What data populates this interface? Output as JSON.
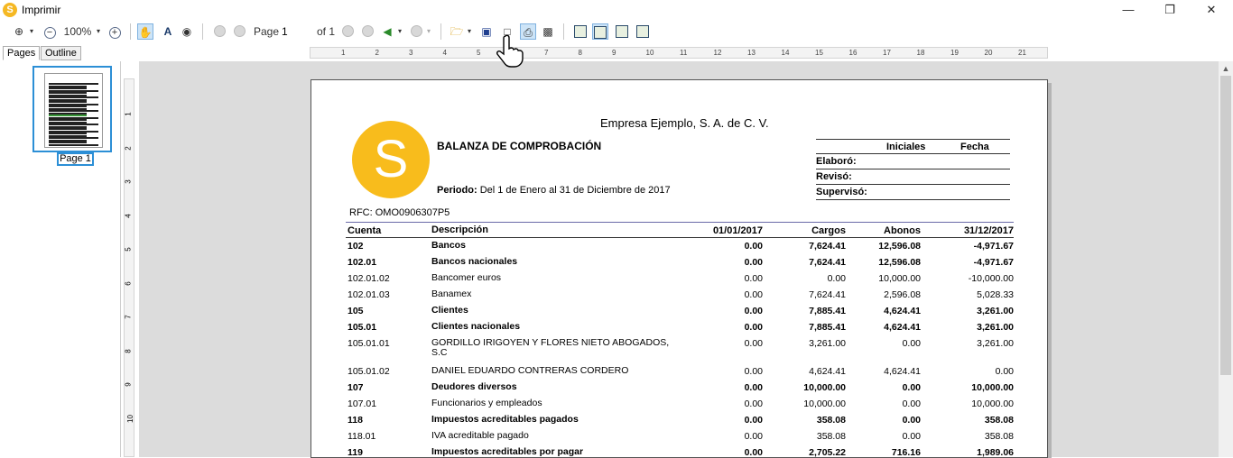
{
  "window": {
    "title": "Imprimir",
    "app_icon": "S"
  },
  "toolbar": {
    "zoom": "100%",
    "page_label": "Page",
    "page_value": "1",
    "of_label": "of 1"
  },
  "sidebar": {
    "tabs": [
      "Pages",
      "Outline"
    ],
    "thumb_label": "Page 1"
  },
  "ruler": {
    "h_numbers": [
      "1",
      "2",
      "3",
      "4",
      "5",
      "6",
      "7",
      "8",
      "9",
      "10",
      "11",
      "12",
      "13",
      "14",
      "15",
      "16",
      "17",
      "18",
      "19",
      "20",
      "21"
    ],
    "v_numbers": [
      "1",
      "2",
      "3",
      "4",
      "5",
      "6",
      "7",
      "8",
      "9",
      "10"
    ]
  },
  "report": {
    "logo_letter": "S",
    "company": "Empresa Ejemplo, S. A. de C. V.",
    "title": "BALANZA DE COMPROBACIÓN",
    "period_label": "Periodo:",
    "period_value": "Del 1 de Enero al 31 de Diciembre de 2017",
    "rfc": "RFC: OMO0906307P5",
    "sign_headers": [
      "Iniciales",
      "Fecha"
    ],
    "sign_rows": [
      "Elaboró:",
      "Revisó:",
      "Supervisó:"
    ],
    "columns": [
      "Cuenta",
      "Descripción",
      "01/01/2017",
      "Cargos",
      "Abonos",
      "31/12/2017"
    ],
    "rows": [
      {
        "cuenta": "102",
        "desc": "Bancos",
        "ini": "0.00",
        "cargos": "7,624.41",
        "abonos": "12,596.08",
        "fin": "-4,971.67",
        "bold": true
      },
      {
        "cuenta": "102.01",
        "desc": "Bancos nacionales",
        "ini": "0.00",
        "cargos": "7,624.41",
        "abonos": "12,596.08",
        "fin": "-4,971.67",
        "bold": true
      },
      {
        "cuenta": "102.01.02",
        "desc": "Bancomer euros",
        "ini": "0.00",
        "cargos": "0.00",
        "abonos": "10,000.00",
        "fin": "-10,000.00",
        "bold": false
      },
      {
        "cuenta": "102.01.03",
        "desc": "Banamex",
        "ini": "0.00",
        "cargos": "7,624.41",
        "abonos": "2,596.08",
        "fin": "5,028.33",
        "bold": false
      },
      {
        "cuenta": "105",
        "desc": "Clientes",
        "ini": "0.00",
        "cargos": "7,885.41",
        "abonos": "4,624.41",
        "fin": "3,261.00",
        "bold": true
      },
      {
        "cuenta": "105.01",
        "desc": "Clientes nacionales",
        "ini": "0.00",
        "cargos": "7,885.41",
        "abonos": "4,624.41",
        "fin": "3,261.00",
        "bold": true
      },
      {
        "cuenta": "105.01.01",
        "desc": "GORDILLO IRIGOYEN Y FLORES NIETO ABOGADOS, S.C",
        "ini": "0.00",
        "cargos": "3,261.00",
        "abonos": "0.00",
        "fin": "3,261.00",
        "bold": false,
        "tall": true
      },
      {
        "cuenta": "105.01.02",
        "desc": "DANIEL EDUARDO CONTRERAS CORDERO",
        "ini": "0.00",
        "cargos": "4,624.41",
        "abonos": "4,624.41",
        "fin": "0.00",
        "bold": false
      },
      {
        "cuenta": "107",
        "desc": "Deudores diversos",
        "ini": "0.00",
        "cargos": "10,000.00",
        "abonos": "0.00",
        "fin": "10,000.00",
        "bold": true
      },
      {
        "cuenta": "107.01",
        "desc": "Funcionarios y empleados",
        "ini": "0.00",
        "cargos": "10,000.00",
        "abonos": "0.00",
        "fin": "10,000.00",
        "bold": false
      },
      {
        "cuenta": "118",
        "desc": "Impuestos acreditables pagados",
        "ini": "0.00",
        "cargos": "358.08",
        "abonos": "0.00",
        "fin": "358.08",
        "bold": true
      },
      {
        "cuenta": "118.01",
        "desc": "IVA acreditable pagado",
        "ini": "0.00",
        "cargos": "358.08",
        "abonos": "0.00",
        "fin": "358.08",
        "bold": false
      },
      {
        "cuenta": "119",
        "desc": "Impuestos acreditables por pagar",
        "ini": "0.00",
        "cargos": "2,705.22",
        "abonos": "716.16",
        "fin": "1,989.06",
        "bold": true
      }
    ]
  },
  "colors": {
    "accent": "#2c8fd6",
    "logo": "#f8bc1c"
  }
}
